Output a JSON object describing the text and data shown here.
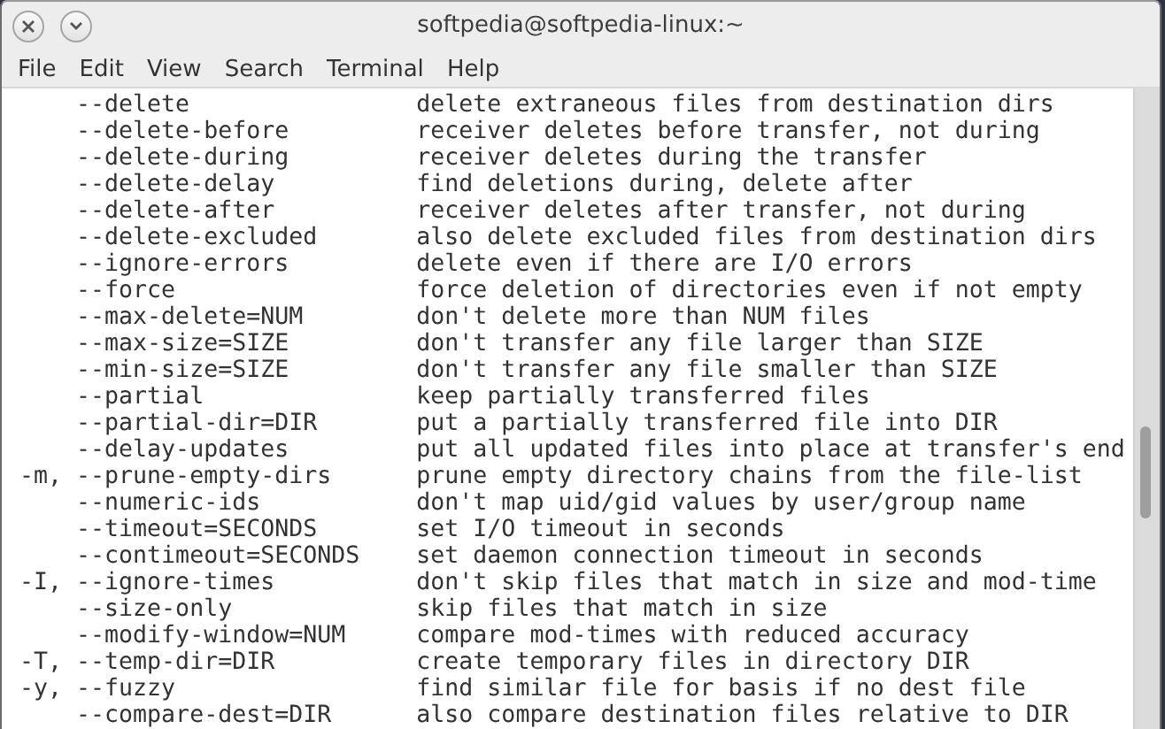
{
  "window": {
    "title": "softpedia@softpedia-linux:~"
  },
  "menu": [
    "File",
    "Edit",
    "View",
    "Search",
    "Terminal",
    "Help"
  ],
  "terminal": {
    "lines": [
      "    --delete                delete extraneous files from destination dirs",
      "    --delete-before         receiver deletes before transfer, not during",
      "    --delete-during         receiver deletes during the transfer",
      "    --delete-delay          find deletions during, delete after",
      "    --delete-after          receiver deletes after transfer, not during",
      "    --delete-excluded       also delete excluded files from destination dirs",
      "    --ignore-errors         delete even if there are I/O errors",
      "    --force                 force deletion of directories even if not empty",
      "    --max-delete=NUM        don't delete more than NUM files",
      "    --max-size=SIZE         don't transfer any file larger than SIZE",
      "    --min-size=SIZE         don't transfer any file smaller than SIZE",
      "    --partial               keep partially transferred files",
      "    --partial-dir=DIR       put a partially transferred file into DIR",
      "    --delay-updates         put all updated files into place at transfer's end",
      "-m, --prune-empty-dirs      prune empty directory chains from the file-list",
      "    --numeric-ids           don't map uid/gid values by user/group name",
      "    --timeout=SECONDS       set I/O timeout in seconds",
      "    --contimeout=SECONDS    set daemon connection timeout in seconds",
      "-I, --ignore-times          don't skip files that match in size and mod-time",
      "    --size-only             skip files that match in size",
      "    --modify-window=NUM     compare mod-times with reduced accuracy",
      "-T, --temp-dir=DIR          create temporary files in directory DIR",
      "-y, --fuzzy                 find similar file for basis if no dest file",
      "    --compare-dest=DIR      also compare destination files relative to DIR"
    ]
  }
}
